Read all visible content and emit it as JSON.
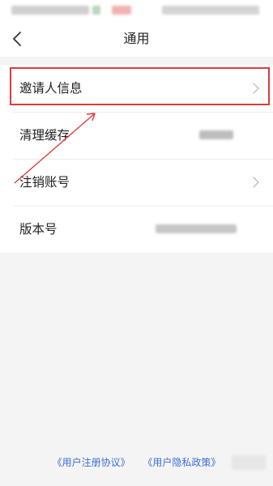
{
  "nav": {
    "title": "通用",
    "back_icon": "back-chevron-icon"
  },
  "settings": {
    "items": [
      {
        "label": "邀请人信息",
        "icon": "chevron-right-icon"
      },
      {
        "label": "清理缓存"
      },
      {
        "label": "注销账号",
        "icon": "chevron-right-icon"
      },
      {
        "label": "版本号"
      }
    ]
  },
  "footer": {
    "links": [
      "《用户注册协议》",
      "《用户隐私政策》"
    ]
  },
  "colors": {
    "highlight": "#e03a3a",
    "link": "#3b6fd8",
    "background": "#f4f4f4"
  }
}
